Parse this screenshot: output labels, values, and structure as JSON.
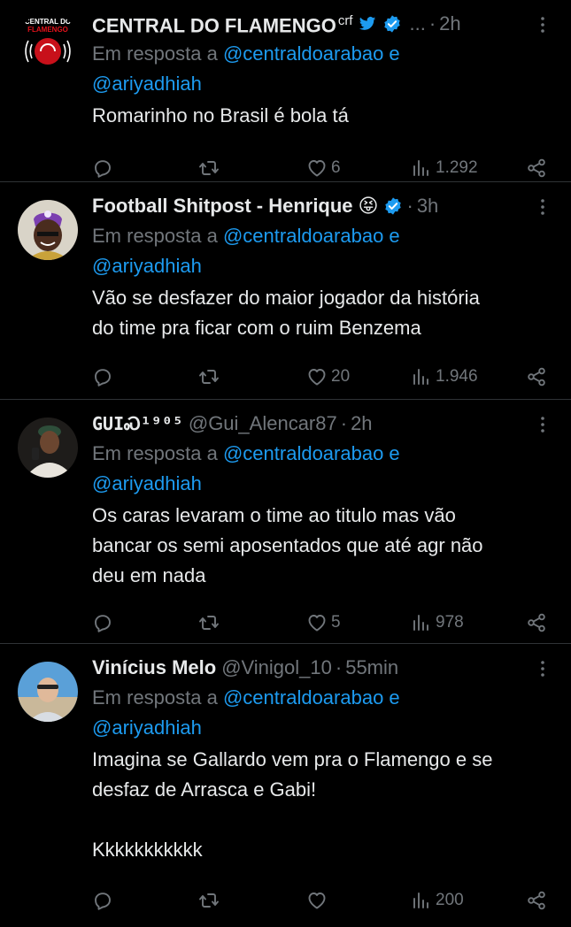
{
  "reply_prefix": "Em resposta a",
  "tweets": [
    {
      "name": "CENTRAL DO FLAMENGO",
      "name_suffix": "crf",
      "handle": "",
      "ellipsis": "...",
      "time": "2h",
      "mentions_1": "@centraldoarabao e",
      "mentions_2": "@ariyadhiah",
      "text": "Romarinho no Brasil é bola tá",
      "replies": "",
      "retweets": "",
      "likes": "6",
      "views": "1.292",
      "avatar_text_top": "CENTRAL DO",
      "avatar_text_bottom": "FLAMENGO"
    },
    {
      "name": "Football Shitpost - Henrique",
      "emoji": "😝",
      "handle": "",
      "time": "3h",
      "mentions_1": "@centraldoarabao e",
      "mentions_2": "@ariyadhiah",
      "text": "Vão se desfazer do maior jogador da história\ndo time pra ficar com o ruim Benzema",
      "replies": "",
      "retweets": "",
      "likes": "20",
      "views": "1.946"
    },
    {
      "name": "GUIᏍ¹⁹⁰⁵",
      "handle": "@Gui_Alencar87",
      "time": "2h",
      "mentions_1": "@centraldoarabao e",
      "mentions_2": "@ariyadhiah",
      "text": "Os caras levaram o time ao titulo mas vão\nbancar os semi aposentados que até agr não\ndeu em nada",
      "replies": "",
      "retweets": "",
      "likes": "5",
      "views": "978"
    },
    {
      "name": "Vinícius Melo",
      "handle": "@Vinigol_10",
      "time": "55min",
      "mentions_1": "@centraldoarabao e",
      "mentions_2": "@ariyadhiah",
      "text": "Imagina se Gallardo vem pra o Flamengo e se\ndesfaz de Arrasca e Gabi!\n\nKkkkkkkkkkk",
      "replies": "",
      "retweets": "",
      "likes": "",
      "views": "200"
    }
  ],
  "icons": {
    "reply": "reply-icon",
    "retweet": "retweet-icon",
    "like": "heart-icon",
    "views": "views-icon",
    "share": "share-icon",
    "more": "more-icon",
    "verified": "verified-badge-icon",
    "bird": "twitter-bird-icon"
  },
  "colors": {
    "background": "#000000",
    "text": "#e7e9ea",
    "muted": "#71767b",
    "link": "#1d9bf0",
    "divider": "#2f3336"
  }
}
